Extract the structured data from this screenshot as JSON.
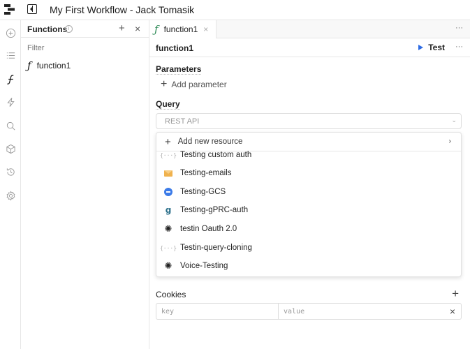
{
  "app": {
    "title": "My First Workflow - Jack Tomasik"
  },
  "rail": {
    "icons": [
      "add-circle-icon",
      "list-icon",
      "function-icon",
      "lightning-icon",
      "search-icon",
      "cube-icon",
      "history-icon",
      "gear-icon"
    ]
  },
  "functions_panel": {
    "title": "Functions",
    "info_glyph": "i",
    "add_glyph": "+",
    "close_glyph": "×",
    "filter_placeholder": "Filter",
    "items": [
      {
        "glyph": "ƒ",
        "label": "function1"
      }
    ]
  },
  "tabs": [
    {
      "glyph": "ƒ",
      "label": "function1",
      "close_glyph": "×",
      "active": true
    }
  ],
  "tabbar": {
    "more_glyph": "···"
  },
  "query_header": {
    "name": "function1",
    "test_label": "Test",
    "more_glyph": "···"
  },
  "parameters": {
    "label": "Parameters",
    "add_glyph": "+",
    "add_label": "Add parameter"
  },
  "query": {
    "label": "Query",
    "selected_value": "REST API",
    "chevron_glyph": "⌄"
  },
  "dropdown": {
    "add_glyph": "+",
    "add_label": "Add new resource",
    "add_arrow": "›",
    "items": [
      {
        "icon": "custom-auth-icon",
        "glyph": "{···}",
        "label": "Testing custom auth"
      },
      {
        "icon": "email-icon",
        "glyph": "",
        "label": "Testing-emails"
      },
      {
        "icon": "gcs-icon",
        "glyph": "",
        "label": "Testing-GCS"
      },
      {
        "icon": "grpc-icon",
        "glyph": "g",
        "label": "Testing-gPRC-auth"
      },
      {
        "icon": "openai-icon",
        "glyph": "✺",
        "label": "testin Oauth 2.0"
      },
      {
        "icon": "custom-auth-icon",
        "glyph": "{···}",
        "label": "Testin-query-cloning"
      },
      {
        "icon": "openai-icon",
        "glyph": "✺",
        "label": "Voice-Testing"
      }
    ]
  },
  "cookies": {
    "label": "Cookies",
    "add_glyph": "+",
    "key_placeholder": "key",
    "value_placeholder": "value",
    "delete_glyph": "×"
  },
  "colors": {
    "accent_blue": "#2d6be4",
    "function_green": "#2e8b57"
  }
}
